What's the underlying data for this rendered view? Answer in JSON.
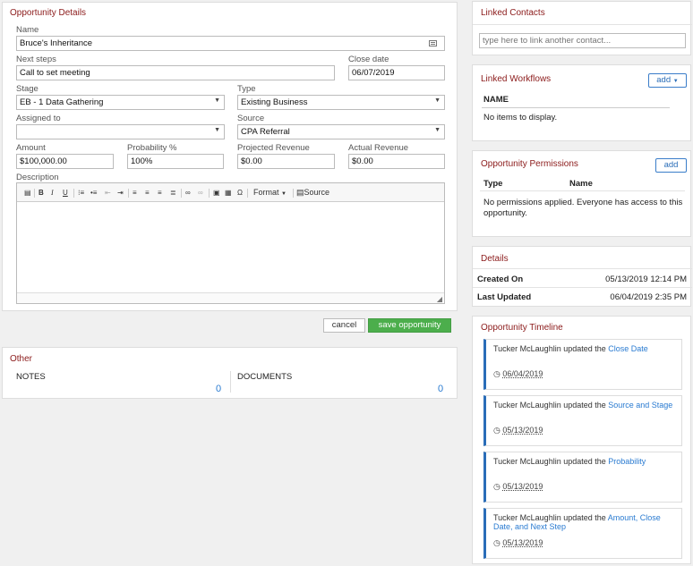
{
  "opportunity": {
    "title": "Opportunity Details",
    "name_label": "Name",
    "name_value": "Bruce's Inheritance",
    "next_steps_label": "Next steps",
    "next_steps_value": "Call to set meeting",
    "close_date_label": "Close date",
    "close_date_value": "06/07/2019",
    "stage_label": "Stage",
    "stage_value": "EB - 1 Data Gathering",
    "type_label": "Type",
    "type_value": "Existing Business",
    "assigned_label": "Assigned to",
    "assigned_value": "",
    "source_label": "Source",
    "source_value": "CPA Referral",
    "amount_label": "Amount",
    "amount_value": "$100,000.00",
    "probability_label": "Probability %",
    "probability_value": "100%",
    "projected_label": "Projected Revenue",
    "projected_value": "$0.00",
    "actual_label": "Actual Revenue",
    "actual_value": "$0.00",
    "description_label": "Description",
    "toolbar": {
      "format_label": "Format",
      "source_label": "Source"
    },
    "cancel_label": "cancel",
    "save_label": "save opportunity"
  },
  "other": {
    "title": "Other",
    "notes_label": "NOTES",
    "notes_count": "0",
    "documents_label": "DOCUMENTS",
    "documents_count": "0"
  },
  "linked_contacts": {
    "title": "Linked Contacts",
    "placeholder": "type here to link another contact..."
  },
  "linked_workflows": {
    "title": "Linked Workflows",
    "add_label": "add",
    "column": "NAME",
    "empty": "No items to display."
  },
  "permissions": {
    "title": "Opportunity Permissions",
    "add_label": "add",
    "col_type": "Type",
    "col_name": "Name",
    "message": "No permissions applied. Everyone has access to this opportunity."
  },
  "details": {
    "title": "Details",
    "created_label": "Created On",
    "created_value": "05/13/2019 12:14 PM",
    "updated_label": "Last Updated",
    "updated_value": "06/04/2019 2:35 PM"
  },
  "timeline": {
    "title": "Opportunity Timeline",
    "entries": [
      {
        "prefix": "Tucker McLaughlin updated the ",
        "link": "Close Date",
        "date": "06/04/2019"
      },
      {
        "prefix": "Tucker McLaughlin updated the ",
        "link": "Source and Stage",
        "date": "05/13/2019"
      },
      {
        "prefix": "Tucker McLaughlin updated the ",
        "link": "Probability",
        "date": "05/13/2019"
      },
      {
        "prefix": "Tucker McLaughlin updated the ",
        "link": "Amount, Close Date, and Next Step",
        "date": "05/13/2019"
      }
    ]
  },
  "colors": {
    "title_red": "#8b1a1a",
    "link_blue": "#2a7bd1",
    "save_green": "#4cae4c",
    "accent_blue": "#2a6db8"
  }
}
